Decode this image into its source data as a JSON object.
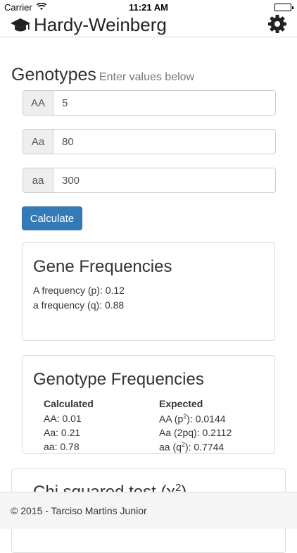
{
  "status": {
    "carrier": "Carrier",
    "time": "11:21 AM"
  },
  "navbar": {
    "title": "Hardy-Weinberg"
  },
  "genotypes": {
    "title": "Genotypes",
    "subtitle": "Enter values below",
    "inputs": [
      {
        "label": "AA",
        "value": "5"
      },
      {
        "label": "Aa",
        "value": "80"
      },
      {
        "label": "aa",
        "value": "300"
      }
    ],
    "calculate": "Calculate"
  },
  "gene_frequencies": {
    "title": "Gene Frequencies",
    "lines": [
      "A frequency (p): 0.12",
      "a frequency (q): 0.88"
    ]
  },
  "genotype_frequencies": {
    "title": "Genotype Frequencies",
    "calculated": {
      "heading": "Calculated",
      "rows": [
        "AA: 0.01",
        "Aa: 0.21",
        "aa: 0.78"
      ]
    },
    "expected": {
      "heading": "Expected",
      "rows": [
        {
          "pre": "AA (p",
          "sup": "2",
          "post": "): 0.0144"
        },
        {
          "pre": "Aa (2pq): 0.2112",
          "sup": "",
          "post": ""
        },
        {
          "pre": "aa (q",
          "sup": "2",
          "post": "): 0.7744"
        }
      ]
    }
  },
  "chi": {
    "pre": "Chi squared test (χ",
    "sup": "2",
    "post": ")"
  },
  "footer": {
    "text": "© 2015 - Tarciso Martins Junior"
  }
}
